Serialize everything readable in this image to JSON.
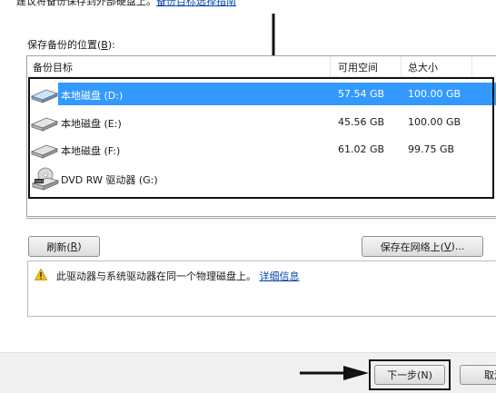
{
  "top_note": {
    "text": "建议将备份保存到外部硬盘上。",
    "link": "备份目标选择指南"
  },
  "backup_location": {
    "label_prefix": "保存备份的位置(",
    "label_key": "B",
    "label_suffix": "):"
  },
  "drive_list": {
    "columns": {
      "target": "备份目标",
      "free": "可用空间",
      "total": "总大小"
    },
    "rows": [
      {
        "name": "本地磁盘 (D:)",
        "free": "57.54 GB",
        "total": "100.00 GB",
        "icon": "hard-drive-icon",
        "selected": true
      },
      {
        "name": "本地磁盘 (E:)",
        "free": "45.56 GB",
        "total": "100.00 GB",
        "icon": "hard-drive-icon",
        "selected": false
      },
      {
        "name": "本地磁盘 (F:)",
        "free": "61.02 GB",
        "total": "99.75 GB",
        "icon": "hard-drive-icon",
        "selected": false
      },
      {
        "name": "DVD RW 驱动器 (G:)",
        "free": "",
        "total": "",
        "icon": "dvd-drive-icon",
        "selected": false
      }
    ],
    "selection_color": "#3399ff"
  },
  "buttons": {
    "refresh_prefix": "刷新(",
    "refresh_key": "R",
    "refresh_suffix": ")",
    "save_network_prefix": "保存在网络上(",
    "save_network_key": "V",
    "save_network_suffix": ")...",
    "next": "下一步(N)",
    "cancel": "取消"
  },
  "message": {
    "icon": "warning-icon",
    "text": "此驱动器与系统驱动器在同一个物理磁盘上。",
    "link": "详细信息"
  },
  "annotations": {
    "arrow_down": "down-arrow-annotation",
    "arrow_right": "right-arrow-annotation",
    "box_color": "#111111"
  }
}
